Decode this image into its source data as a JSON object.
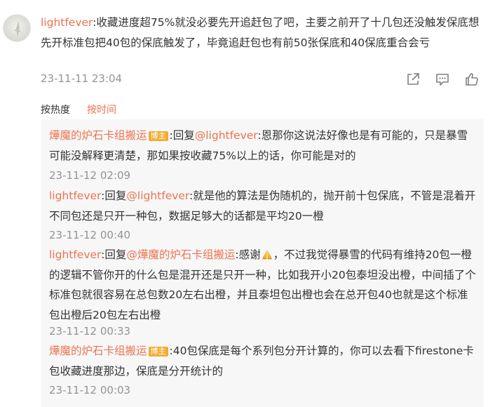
{
  "comment": {
    "user": "lightfever",
    "text": ":收藏进度超75%就没必要先开追赶包了吧，主要之前开了十几包还没触发保底想先开标准包把40包的保底触发了，毕竟追赶包也有前50张保底和40保底重合会亏",
    "time": "23-11-11 23:04"
  },
  "sort": {
    "by_hot": "按热度",
    "by_time": "按时间"
  },
  "replies": [
    {
      "user": "燁魔的炉石卡组搬运",
      "badge": "博主",
      "prefix": ":回复",
      "mention": "@lightfever",
      "text": ":恩那你这说法好像也是有可能的，只是暴雪可能没解释更清楚，那如果按收藏75%以上的话，你可能是对的",
      "time": "23-11-12 02:09"
    },
    {
      "user": "lightfever",
      "prefix": ":回复",
      "mention": "@lightfever",
      "text": ":就是他的算法是伪随机的，抛开前十包保底，不管是混着开不同包还是只开一种包，数据足够大的话都是平均20一橙",
      "time": "23-11-12 00:40"
    },
    {
      "user": "lightfever",
      "prefix": ":回复",
      "mention": "@燁魔的炉石卡组搬运",
      "text_a": ":感谢",
      "text_b": "，不过我觉得暴雪的代码有维持20包一橙的逻辑不管你开的什么包是混开还是只开一种，比如我开小20包泰坦没出橙，中间插了个标准包就很容易在总包数20左右出橙，并且泰坦包出橙也会在总开包40也就是这个标准包出橙后20包左右出橙",
      "time": "23-11-12 00:33"
    },
    {
      "user": "燁魔的炉石卡组搬运",
      "badge": "博主",
      "text": ":40包保底是每个系列包分开计算的，你可以去看下firestone卡包收藏进度那边，保底是分开统计的",
      "time": "23-11-12 00:03"
    }
  ],
  "colors": {
    "accent": "#eb7350",
    "muted": "#939393",
    "badge": "#f0ad33",
    "reply_bg": "#f7f7f7"
  },
  "icons": [
    "share-icon",
    "comment-icon",
    "like-icon",
    "pray-emoji"
  ]
}
